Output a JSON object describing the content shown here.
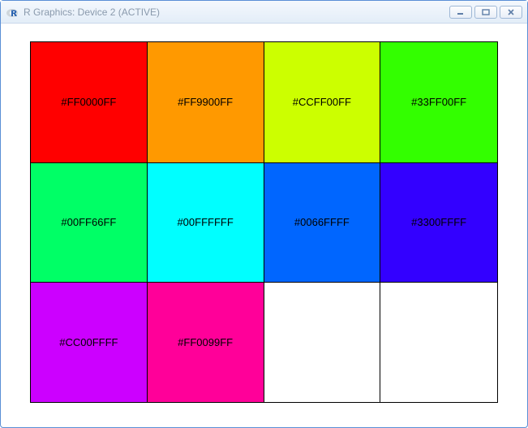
{
  "window": {
    "title": "R Graphics: Device 2 (ACTIVE)"
  },
  "grid": {
    "cells": [
      {
        "hex": "#FF0000FF",
        "bg": "#FF0000"
      },
      {
        "hex": "#FF9900FF",
        "bg": "#FF9900"
      },
      {
        "hex": "#CCFF00FF",
        "bg": "#CCFF00"
      },
      {
        "hex": "#33FF00FF",
        "bg": "#33FF00"
      },
      {
        "hex": "#00FF66FF",
        "bg": "#00FF66"
      },
      {
        "hex": "#00FFFFFF",
        "bg": "#00FFFF"
      },
      {
        "hex": "#0066FFFF",
        "bg": "#0066FF"
      },
      {
        "hex": "#3300FFFF",
        "bg": "#3300FF"
      },
      {
        "hex": "#CC00FFFF",
        "bg": "#CC00FF"
      },
      {
        "hex": "#FF0099FF",
        "bg": "#FF0099"
      },
      {
        "hex": "",
        "bg": "#FFFFFF"
      },
      {
        "hex": "",
        "bg": "#FFFFFF"
      }
    ]
  }
}
